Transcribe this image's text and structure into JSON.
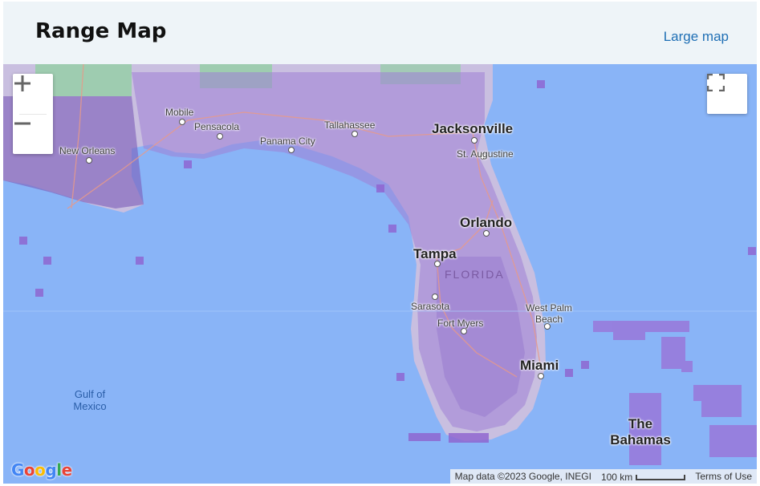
{
  "header": {
    "title": "Range Map",
    "large_map_link": "Large map"
  },
  "map": {
    "cities": [
      {
        "name": "Jacksonville",
        "size": "big"
      },
      {
        "name": "St. Augustine",
        "size": "small"
      },
      {
        "name": "Orlando",
        "size": "big"
      },
      {
        "name": "Tampa",
        "size": "big"
      },
      {
        "name": "Sarasota",
        "size": "small"
      },
      {
        "name": "Fort Myers",
        "size": "small"
      },
      {
        "name": "West Palm Beach",
        "size": "small"
      },
      {
        "name": "Miami",
        "size": "big"
      },
      {
        "name": "Tallahassee",
        "size": "small"
      },
      {
        "name": "Panama City",
        "size": "small"
      },
      {
        "name": "Pensacola",
        "size": "small"
      },
      {
        "name": "Mobile",
        "size": "small"
      },
      {
        "name": "New Orleans",
        "size": "small"
      },
      {
        "name": "The Bahamas",
        "size": "big"
      }
    ],
    "region_label": "FLORIDA",
    "water_label": "Gulf of Mexico",
    "controls": {
      "zoom_in": "+",
      "zoom_out": "−"
    },
    "google_logo": "Google",
    "attribution": {
      "map_data": "Map data ©2023 Google, INEGI",
      "scale": "100 km",
      "terms": "Terms of Use"
    },
    "colors": {
      "water": "#89b4f7",
      "land": "#c7b9de",
      "range_light": "#b48ee0",
      "range_dark": "#5b3b8c"
    }
  }
}
